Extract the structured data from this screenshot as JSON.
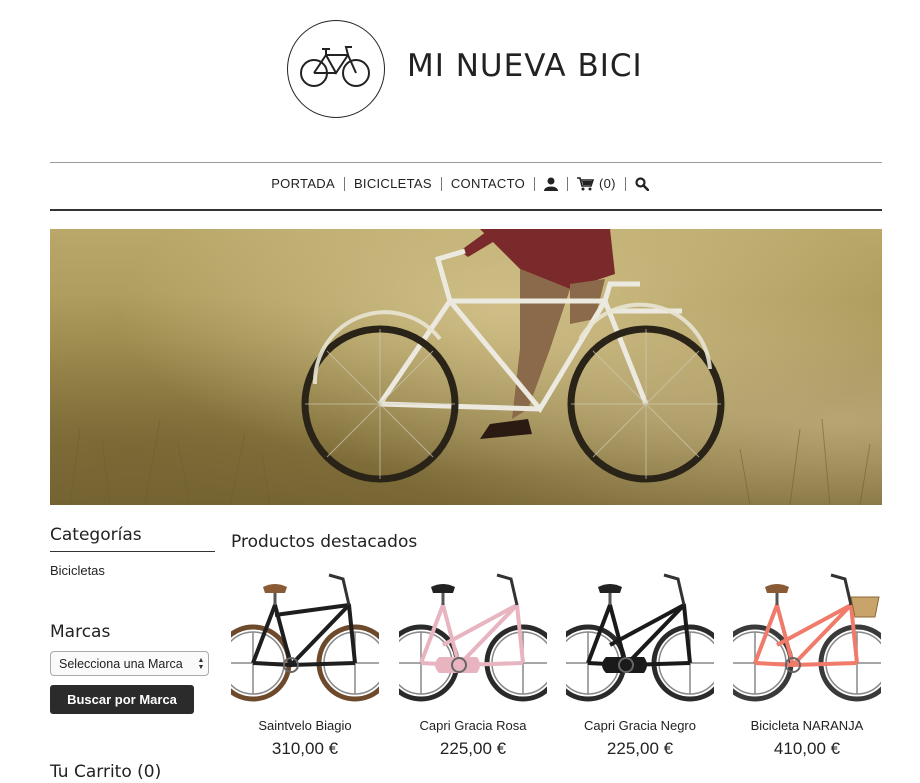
{
  "brand": {
    "name": "MI NUEVA BICI"
  },
  "nav": {
    "items": [
      "PORTADA",
      "BICICLETAS",
      "CONTACTO"
    ],
    "cart_count": "(0)"
  },
  "sidebar": {
    "categories_title": "Categorías",
    "categories": [
      "Bicicletas"
    ],
    "brands_title": "Marcas",
    "brand_select_value": "Selecciona una Marca",
    "brand_button": "Buscar por Marca",
    "cart_title": "Tu Carrito (0)"
  },
  "featured": {
    "title": "Productos destacados",
    "products": [
      {
        "name": "Saintvelo Biagio",
        "price": "310,00 €",
        "frame_color": "#1e1e1e",
        "tire_color": "#6e4a2c"
      },
      {
        "name": "Capri Gracia Rosa",
        "price": "225,00 €",
        "frame_color": "#e8b4c0",
        "tire_color": "#2a2a2a"
      },
      {
        "name": "Capri Gracia Negro",
        "price": "225,00 €",
        "frame_color": "#1a1a1a",
        "tire_color": "#2a2a2a"
      },
      {
        "name": "Bicicleta NARANJA",
        "price": "410,00 €",
        "frame_color": "#f07b6a",
        "tire_color": "#3a3a3a"
      }
    ]
  },
  "colors": {
    "accent_dark": "#2b2b2b",
    "text": "#222222"
  }
}
